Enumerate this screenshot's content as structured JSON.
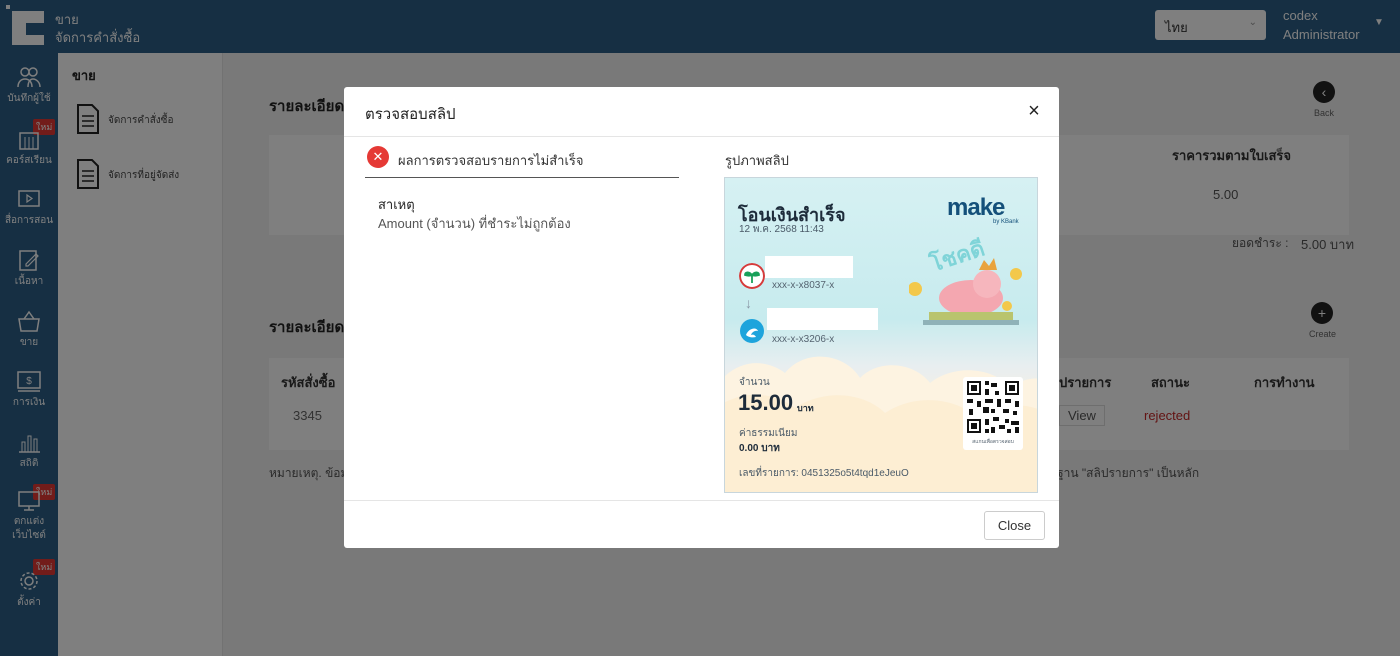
{
  "app": {
    "title_line1": "ขาย",
    "title_line2": "จัดการคำสั่งซื้อ",
    "language": "ไทย",
    "user_name": "codex",
    "user_role": "Administrator"
  },
  "sidebar": {
    "items": [
      {
        "label": "บันทึกผู้ใช้",
        "icon": "users-icon"
      },
      {
        "label": "คอร์สเรียน",
        "icon": "building-icon",
        "badge": "ใหม่"
      },
      {
        "label": "สื่อการสอน",
        "icon": "video-icon"
      },
      {
        "label": "เนื้อหา",
        "icon": "edit-icon"
      },
      {
        "label": "ขาย",
        "icon": "basket-icon"
      },
      {
        "label": "การเงิน",
        "icon": "money-icon"
      },
      {
        "label": "สถิติ",
        "icon": "chart-icon"
      },
      {
        "label": "ตกแต่ง เว็บไซต์",
        "icon": "monitor-icon",
        "badge": "ใหม่"
      },
      {
        "label": "ตั้งค่า",
        "icon": "gear-icon",
        "badge": "ใหม่"
      }
    ]
  },
  "subnav": {
    "heading": "ขาย",
    "items": [
      "จัดการคำสั่งซื้อ",
      "จัดการที่อยู่จัดส่ง"
    ]
  },
  "background": {
    "section1_title": "รายละเอียดร",
    "section2_title": "รายละเอียดก",
    "col_total_invoice": "ราคารวมตามใบเสร็จ",
    "total_value": "5.00",
    "paid_label": "ยอดชำระ :",
    "paid_value": "5.00 บาท",
    "back_label": "Back",
    "create_label": "Create",
    "table_headers": [
      "รหัสสั่งซื้อ",
      "ปรายการ",
      "สถานะ",
      "การทำงาน"
    ],
    "row_order_id": "3345",
    "row_view": "View",
    "row_status": "rejected",
    "note_left": "หมายเหตุ. ข้อม",
    "note_right": "ฐาน \"สลิปรายการ\" เป็นหลัก",
    "small_s": "ร"
  },
  "modal": {
    "title": "ตรวจสอบสลิป",
    "close_icon": "×",
    "result_text": "ผลการตรวจสอบรายการไม่สำเร็จ",
    "reason_label": "สาเหตุ",
    "reason_text": "Amount (จำนวน) ที่ชำระไม่ถูกต้อง",
    "slip_title": "รูปภาพสลิป",
    "close_button": "Close"
  },
  "slip": {
    "heading": "โอนเงินสำเร็จ",
    "datetime": "12 พ.ค. 2568 11:43",
    "brand": "make",
    "brand_sub": "by KBank",
    "from_account": "xxx-x-x8037-x",
    "to_account": "xxx-x-x3206-x",
    "amount_label": "จำนวน",
    "amount_value": "15.00",
    "amount_unit": "บาท",
    "fee_label": "ค่าธรรมเนียม",
    "fee_value": "0.00 บาท",
    "reference": "เลขที่รายการ: 0451325o5t4tqd1eJeuO",
    "lucky_text": "โชคดี",
    "qr_caption": "สแกนเพื่อตรวจสอบ"
  },
  "colors": {
    "nav_bg": "#2c5f86",
    "error": "#e53935",
    "status_rejected": "#c62828"
  }
}
